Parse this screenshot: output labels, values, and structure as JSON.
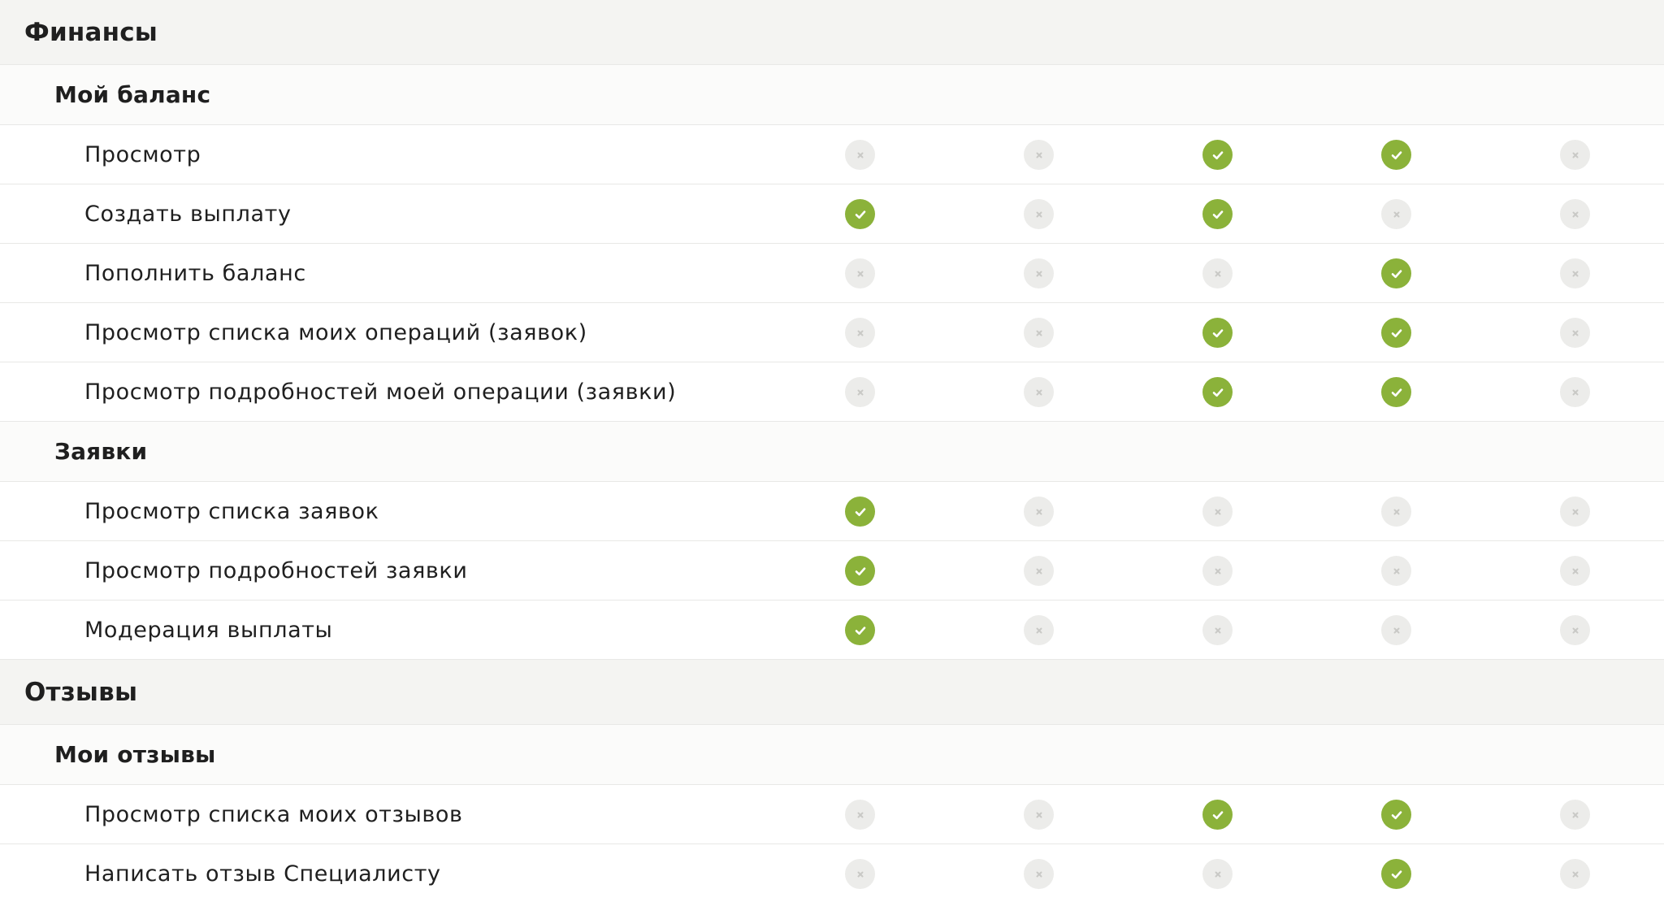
{
  "columns_count": 5,
  "colors": {
    "allowed": "#8bb23a",
    "denied": "#ececea",
    "section_bg": "#f4f4f2",
    "group_bg": "#fbfbfa",
    "row_border": "#e8e8e6"
  },
  "sections": [
    {
      "title": "Финансы",
      "groups": [
        {
          "title": "Мой баланс",
          "rows": [
            {
              "label": "Просмотр",
              "perms": [
                false,
                false,
                true,
                true,
                false
              ]
            },
            {
              "label": "Создать выплату",
              "perms": [
                true,
                false,
                true,
                false,
                false
              ]
            },
            {
              "label": "Пополнить баланс",
              "perms": [
                false,
                false,
                false,
                true,
                false
              ]
            },
            {
              "label": "Просмотр списка моих операций (заявок)",
              "perms": [
                false,
                false,
                true,
                true,
                false
              ]
            },
            {
              "label": "Просмотр подробностей моей операции (заявки)",
              "perms": [
                false,
                false,
                true,
                true,
                false
              ]
            }
          ]
        },
        {
          "title": "Заявки",
          "rows": [
            {
              "label": "Просмотр списка заявок",
              "perms": [
                true,
                false,
                false,
                false,
                false
              ]
            },
            {
              "label": "Просмотр подробностей заявки",
              "perms": [
                true,
                false,
                false,
                false,
                false
              ]
            },
            {
              "label": "Модерация выплаты",
              "perms": [
                true,
                false,
                false,
                false,
                false
              ]
            }
          ]
        }
      ]
    },
    {
      "title": "Отзывы",
      "groups": [
        {
          "title": "Мои отзывы",
          "rows": [
            {
              "label": "Просмотр списка моих отзывов",
              "perms": [
                false,
                false,
                true,
                true,
                false
              ]
            },
            {
              "label": "Написать отзыв Специалисту",
              "perms": [
                false,
                false,
                false,
                true,
                false
              ]
            }
          ]
        }
      ]
    }
  ]
}
